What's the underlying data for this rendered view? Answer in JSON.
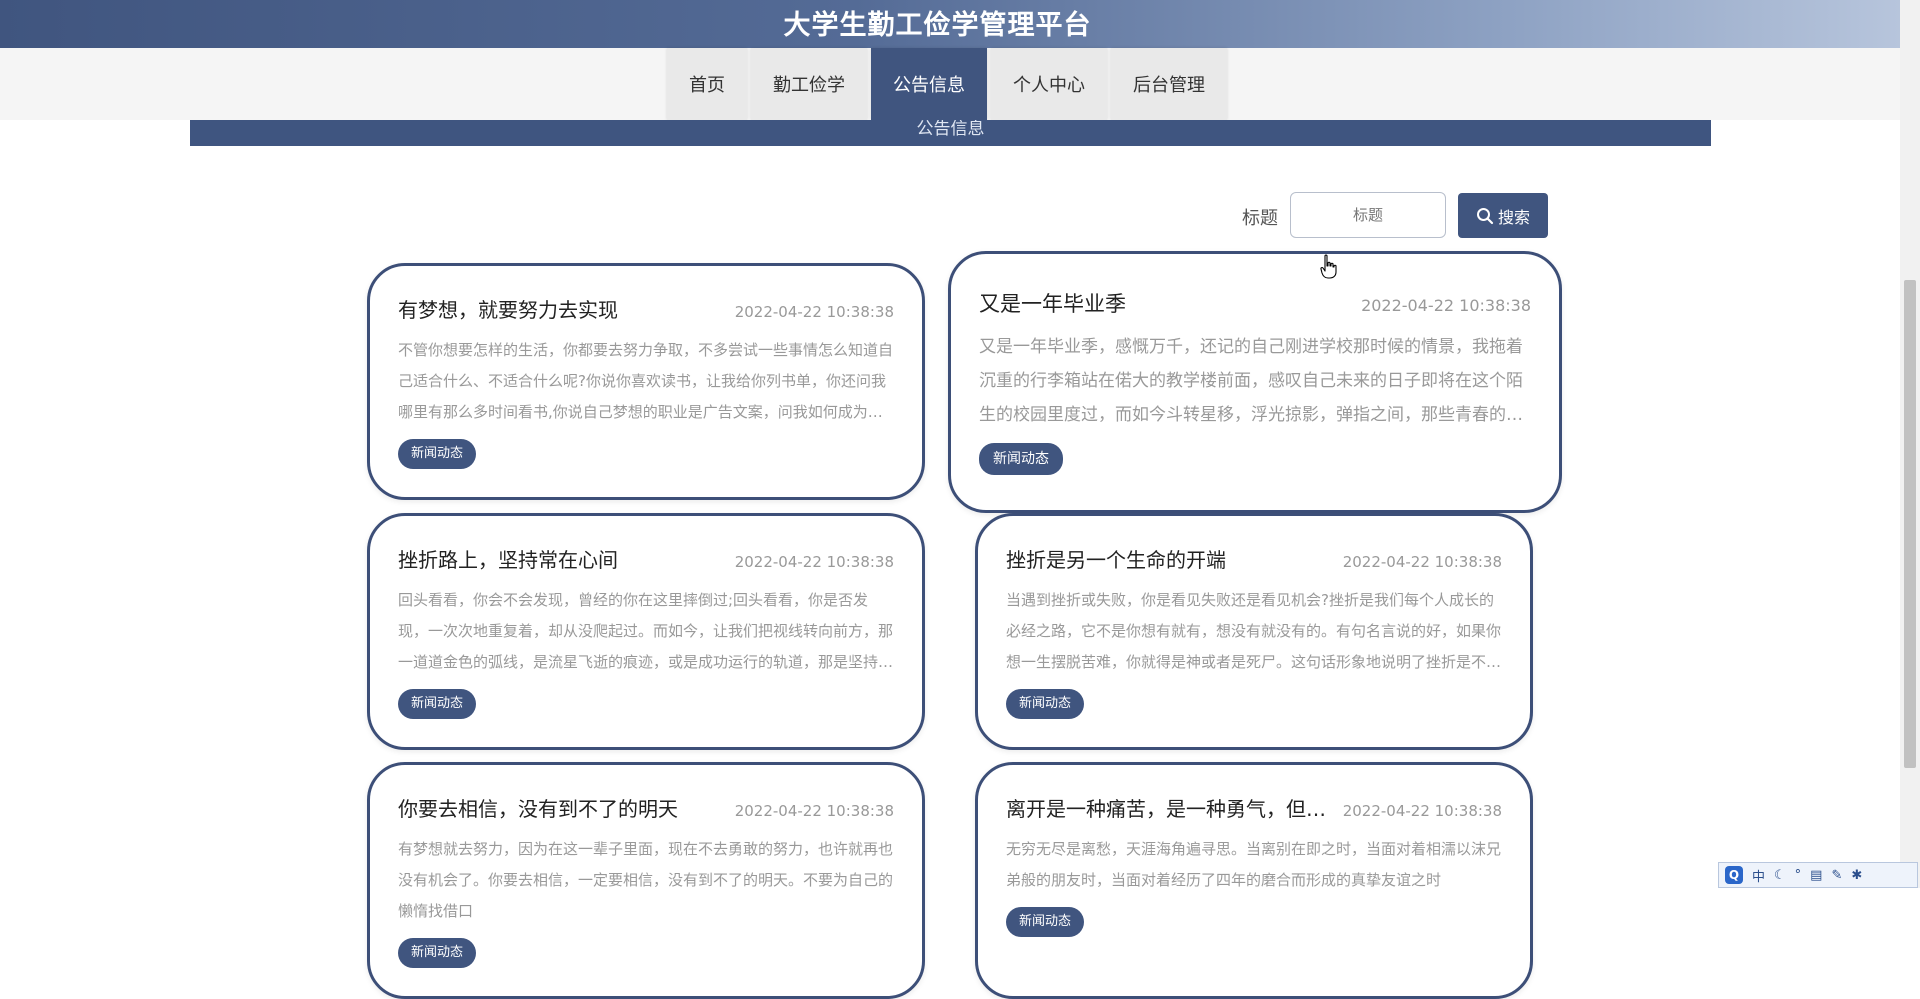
{
  "header": {
    "title": "大学生勤工俭学管理平台"
  },
  "nav": {
    "items": [
      {
        "label": "首页",
        "active": false
      },
      {
        "label": "勤工俭学",
        "active": false
      },
      {
        "label": "公告信息",
        "active": true
      },
      {
        "label": "个人中心",
        "active": false
      },
      {
        "label": "后台管理",
        "active": false
      }
    ]
  },
  "banner": {
    "text": "公告信息"
  },
  "search": {
    "label": "标题",
    "placeholder": "标题",
    "value": "",
    "button_label": "搜索"
  },
  "cards": [
    {
      "title": "有梦想，就要努力去实现",
      "date": "2022-04-22 10:38:38",
      "summary": "不管你想要怎样的生活，你都要去努力争取，不多尝试一些事情怎么知道自己适合什么、不适合什么呢?你说你喜欢读书，让我给你列书单，你还问我哪里有那么多时间看书,你说自己梦想的职业是广告文案，问我如何成为一个文案",
      "tag": "新闻动态"
    },
    {
      "title": "又是一年毕业季",
      "date": "2022-04-22 10:38:38",
      "summary": "又是一年毕业季，感慨万千，还记的自己刚进学校那时候的情景，我拖着沉重的行李箱站在偌大的教学楼前面，感叹自己未来的日子即将在这个陌生的校园里度过，而如今斗转星移，浮光掠影，弹指之间，那些青春的日子已经离我远去",
      "tag": "新闻动态"
    },
    {
      "title": "挫折路上，坚持常在心间",
      "date": "2022-04-22 10:38:38",
      "summary": "回头看看，你会不会发现，曾经的你在这里摔倒过;回头看看，你是否发现，一次次地重复着，却从没爬起过。而如今，让我们把视线转向前方，那一道道金色的弧线，是流星飞逝的痕迹，或是成功运行的轨道，那是坚持的力量",
      "tag": "新闻动态"
    },
    {
      "title": "挫折是另一个生命的开端",
      "date": "2022-04-22 10:38:38",
      "summary": "当遇到挫折或失败，你是看见失败还是看见机会?挫折是我们每个人成长的必经之路，它不是你想有就有，想没有就没有的。有句名言说的好，如果你想一生摆脱苦难，你就得是神或者是死尸。这句话形象地说明了挫折是不可避免的",
      "tag": "新闻动态"
    },
    {
      "title": "你要去相信，没有到不了的明天",
      "date": "2022-04-22 10:38:38",
      "summary": "有梦想就去努力，因为在这一辈子里面，现在不去勇敢的努力，也许就再也没有机会了。你要去相信，一定要相信，没有到不了的明天。不要为自己的懒惰找借口",
      "tag": "新闻动态"
    },
    {
      "title": "离开是一种痛苦，是一种勇气，但同样也是一个考验",
      "date": "2022-04-22 10:38:38",
      "summary": "无穷无尽是离愁，天涯海角遍寻思。当离别在即之时，当面对着相濡以沫兄弟般的朋友时，当面对着经历了四年的磨合而形成的真挚友谊之时",
      "tag": "新闻动态"
    }
  ],
  "ime": {
    "lang": "中",
    "q": "Q"
  }
}
